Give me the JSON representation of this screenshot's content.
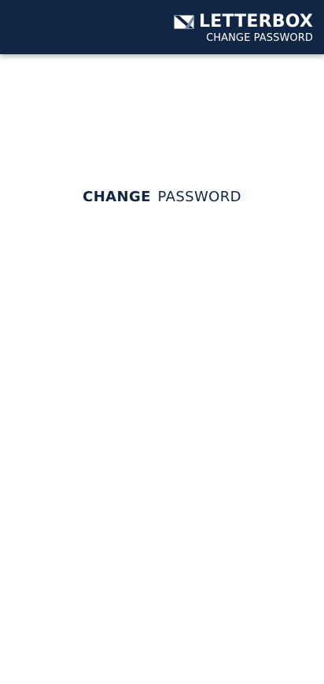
{
  "header": {
    "brand_name": "LETTERBOX",
    "subtitle": "CHANGE PASSWORD",
    "logo_icon": "envelope-logo-icon",
    "background_color": "#112544",
    "text_color": "#ffffff"
  },
  "main": {
    "title_strong": "CHANGE",
    "title_light": "PASSWORD",
    "title_color": "#112544"
  }
}
